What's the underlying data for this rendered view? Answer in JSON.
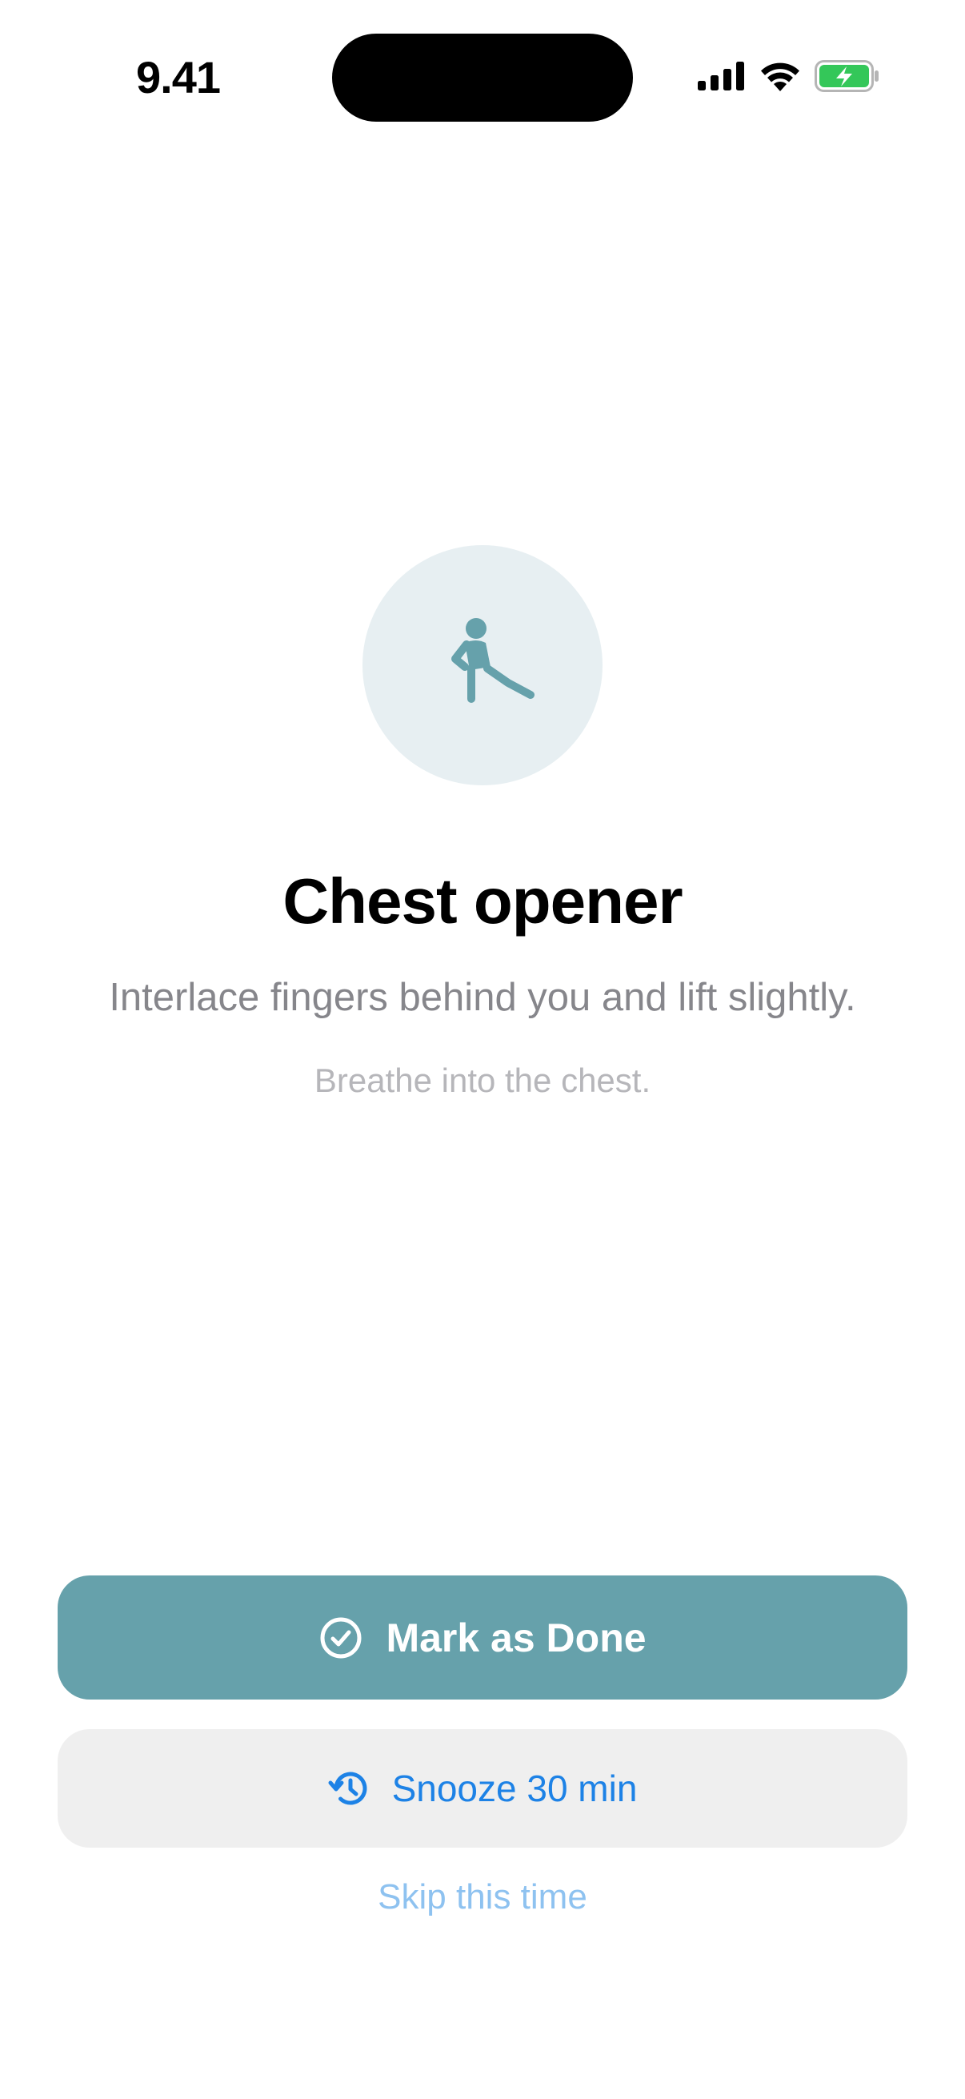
{
  "status_bar": {
    "time": "9.41",
    "icons": [
      "cellular-signal-icon",
      "wifi-icon",
      "battery-charging-icon"
    ]
  },
  "exercise": {
    "icon": "stretching-figure-icon",
    "title": "Chest opener",
    "instruction": "Interlace fingers behind you and lift slightly.",
    "hint": "Breathe into the chest."
  },
  "actions": {
    "done_label": "Mark as Done",
    "done_icon": "checkmark-circle-icon",
    "snooze_label": "Snooze 30 min",
    "snooze_icon": "clock-history-icon",
    "skip_label": "Skip this time"
  },
  "colors": {
    "accent": "#66a1ab",
    "hero_bg": "#e7eff2",
    "link_blue": "#1d82e6",
    "skip_blue": "#8ec2f0",
    "battery_green": "#34c759"
  }
}
